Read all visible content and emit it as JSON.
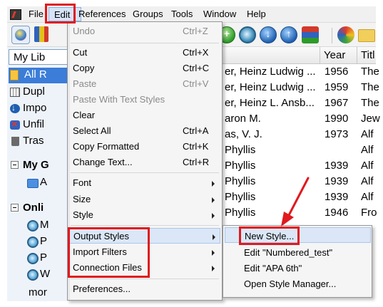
{
  "menubar": {
    "items": [
      "File",
      "Edit",
      "References",
      "Groups",
      "Tools",
      "Window",
      "Help"
    ]
  },
  "left_panel": {
    "library_select": "My Lib",
    "all_references": "All R",
    "items": [
      "Dupl",
      "Impo",
      "Unfil",
      "Tras"
    ],
    "groups": [
      {
        "label": "My G",
        "children": [
          "A"
        ]
      },
      {
        "label": "Onli",
        "children": [
          "M",
          "P",
          "P",
          "W"
        ]
      }
    ],
    "more": "mor"
  },
  "table": {
    "col_year": "Year",
    "col_title": "Titl",
    "rows": [
      {
        "author": "er, Heinz Ludwig ...",
        "year": "1956",
        "title": "The"
      },
      {
        "author": "er, Heinz Ludwig ...",
        "year": "1959",
        "title": "The"
      },
      {
        "author": "er, Heinz L. Ansb...",
        "year": "1967",
        "title": "The"
      },
      {
        "author": "aron M.",
        "year": "1990",
        "title": "Jew"
      },
      {
        "author": "as, V. J.",
        "year": "1973",
        "title": "Alf"
      },
      {
        "author": "Phyllis",
        "year": "",
        "title": "Alf"
      },
      {
        "author": "Phyllis",
        "year": "1939",
        "title": "Alf"
      },
      {
        "author": "Phyllis",
        "year": "1939",
        "title": "Alf"
      },
      {
        "author": "Phyllis",
        "year": "1939",
        "title": "Alf"
      },
      {
        "author": "Phyllis",
        "year": "1946",
        "title": "Fro"
      }
    ]
  },
  "edit_menu": {
    "undo": {
      "label": "Undo",
      "shortcut": "Ctrl+Z"
    },
    "cut": {
      "label": "Cut",
      "shortcut": "Ctrl+X"
    },
    "copy": {
      "label": "Copy",
      "shortcut": "Ctrl+C"
    },
    "paste": {
      "label": "Paste",
      "shortcut": "Ctrl+V"
    },
    "paste_styles": {
      "label": "Paste With Text Styles"
    },
    "clear": {
      "label": "Clear"
    },
    "select_all": {
      "label": "Select All",
      "shortcut": "Ctrl+A"
    },
    "copy_formatted": {
      "label": "Copy Formatted",
      "shortcut": "Ctrl+K"
    },
    "change_text": {
      "label": "Change Text...",
      "shortcut": "Ctrl+R"
    },
    "font": {
      "label": "Font"
    },
    "size": {
      "label": "Size"
    },
    "style": {
      "label": "Style"
    },
    "output_styles": {
      "label": "Output Styles"
    },
    "import_filters": {
      "label": "Import Filters"
    },
    "connection_files": {
      "label": "Connection Files"
    },
    "preferences": {
      "label": "Preferences..."
    }
  },
  "output_styles_submenu": {
    "new_style": "New Style...",
    "edit_numbered": "Edit \"Numbered_test\"",
    "edit_apa": "Edit \"APA 6th\"",
    "open_manager": "Open Style Manager..."
  },
  "colors": {
    "highlight_red": "#e0191e",
    "selection_blue": "#3b7dd8",
    "menu_hover": "#dbe7f7"
  }
}
